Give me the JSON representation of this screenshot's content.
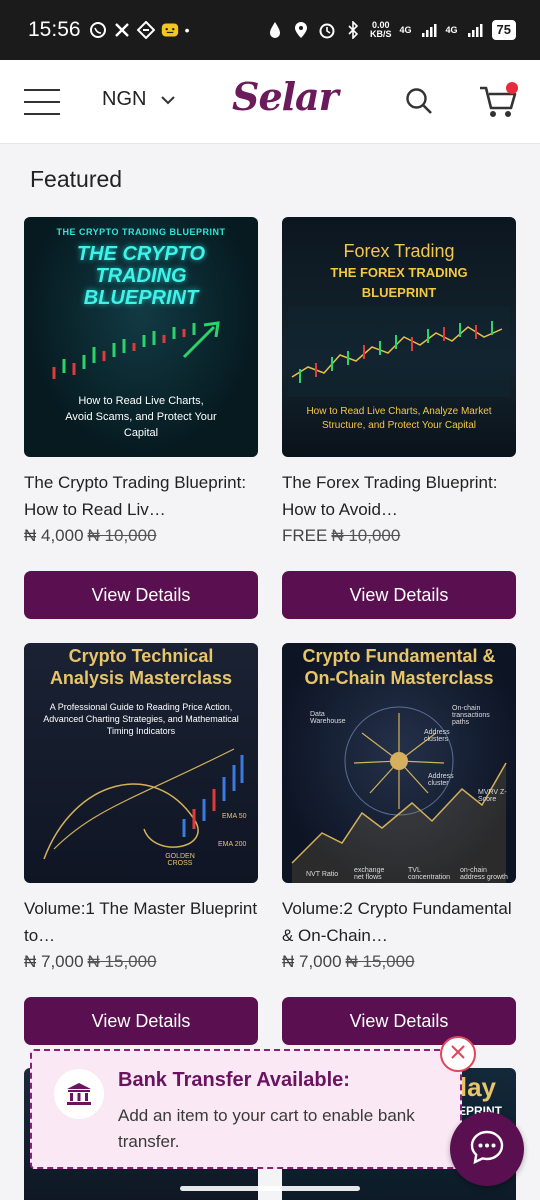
{
  "status_bar": {
    "time": "15:56",
    "net_speed_top": "0.00",
    "net_speed_unit": "KB/S",
    "signal_1": "4G",
    "signal_2": "4G",
    "battery": "75"
  },
  "header": {
    "currency": "NGN",
    "logo": "Selar"
  },
  "main": {
    "section_title": "Featured",
    "products": [
      {
        "cover_title_small": "THE CRYPTO TRADING BLUEPRINT",
        "cover_title_big": "THE CRYPTO TRADING BLUEPRINT",
        "cover_subtitle": "How to Read Live Charts, Avoid Scams, and Protect Your Capital",
        "title": "The Crypto Trading Blueprint: How to Read Liv…",
        "price": "₦ 4,000",
        "old_price": "₦ 10,000",
        "button": "View Details"
      },
      {
        "cover_title_small": "Forex Trading",
        "cover_title_big": "THE FOREX TRADING BLUEPRINT",
        "cover_subtitle": "How to Read Live Charts, Analyze Market Structure, and Protect Your Capital",
        "title": "The Forex Trading Blueprint: How to Avoid…",
        "price": "FREE",
        "old_price": "₦ 10,000",
        "button": "View Details"
      },
      {
        "cover_title_big": "Crypto Technical Analysis Masterclass",
        "cover_subtitle": "A Professional Guide to Reading Price Action, Advanced Charting Strategies, and Mathematical Timing Indicators",
        "cover_labels": [
          "EMA 50",
          "EMA 200",
          "GOLDEN CROSS"
        ],
        "title": "Volume:1 The Master Blueprint to…",
        "price": "₦ 7,000",
        "old_price": "₦ 15,000",
        "button": "View Details"
      },
      {
        "cover_title_big": "Crypto Fundamental & On-Chain Masterclass",
        "cover_labels": [
          "Data Warehouse",
          "On-chain transactions paths",
          "Address clusters",
          "Address cluster",
          "MVRV Z-Score",
          "NVT Ratio",
          "exchange net flows",
          "TVL concentration",
          "on-chain address growth"
        ],
        "title": "Volume:2 Crypto Fundamental & On-Chain…",
        "price": "₦ 7,000",
        "old_price": "₦ 15,000",
        "button": "View Details"
      }
    ],
    "peek_right_text": "play",
    "peek_right_sub": "EPRINT"
  },
  "banner": {
    "title": "Bank Transfer Available:",
    "text": "Add an item to your cart to enable bank transfer."
  },
  "colors": {
    "brand": "#5a1050",
    "banner_bg": "#fbe8f5",
    "cart_dot": "#e62b3a"
  },
  "icons": [
    "whatsapp-icon",
    "x-icon",
    "app-icon",
    "emoji-icon",
    "menu-icon",
    "chevron-down-icon",
    "search-icon",
    "cart-icon",
    "bank-icon",
    "close-icon",
    "chat-icon"
  ]
}
